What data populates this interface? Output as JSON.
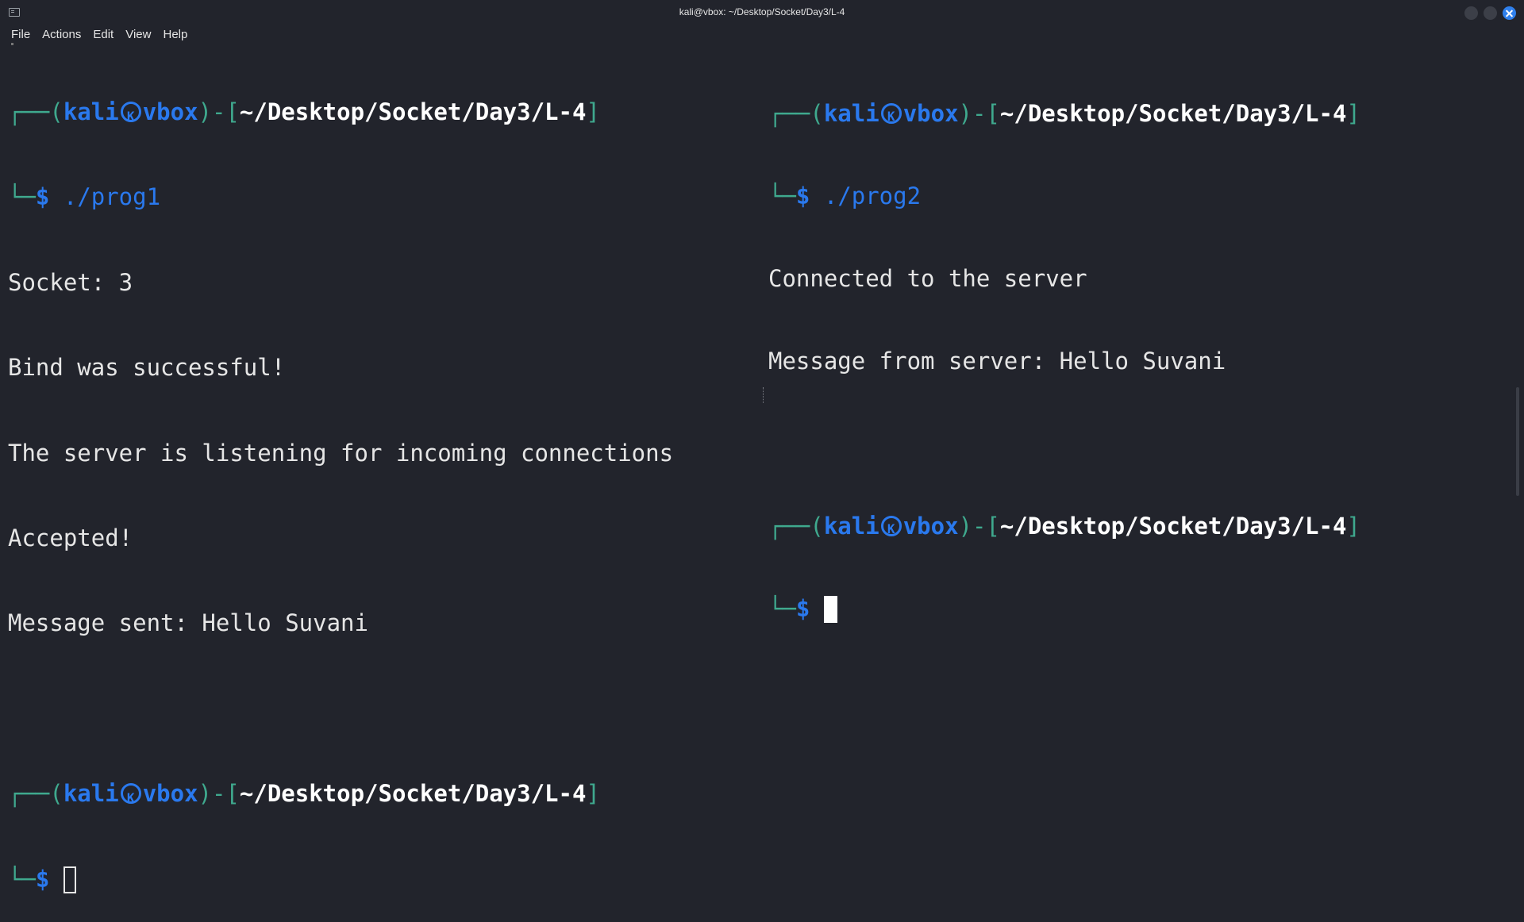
{
  "window": {
    "title": "kali@vbox: ~/Desktop/Socket/Day3/L-4"
  },
  "menu": [
    "File",
    "Actions",
    "Edit",
    "View",
    "Help"
  ],
  "prompt": {
    "user": "kali",
    "host": "vbox",
    "path": "~/Desktop/Socket/Day3/L-4"
  },
  "left_pane": {
    "command": "./prog1",
    "output": [
      "Socket: 3",
      "Bind was successful!",
      "The server is listening for incoming connections",
      "Accepted!",
      "Message sent: Hello Suvani"
    ]
  },
  "right_pane": {
    "command": "./prog2",
    "output": [
      "Connected to the server",
      "Message from server: Hello Suvani"
    ]
  },
  "colors": {
    "background": "#22242c",
    "accent_blue": "#2a79ee",
    "box_green": "#3fa98e",
    "text": "#e6e6e6"
  },
  "icons": [
    "terminal-icon",
    "kali-skull-icon",
    "minimize-icon",
    "maximize-icon",
    "close-icon"
  ]
}
